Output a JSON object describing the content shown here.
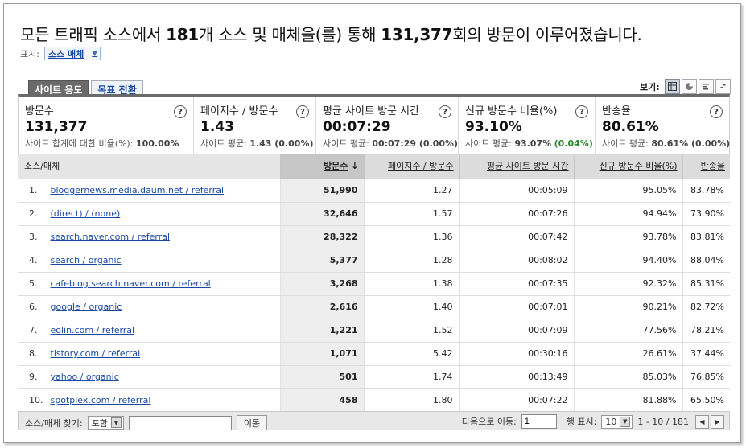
{
  "headline": {
    "part1": "모든 트래픽 소스에서 ",
    "sources": "181",
    "part2": "개 소스 및 매체을(를) 통해 ",
    "visits": "131,377",
    "part3": "회의 방문이 이루어졌습니다."
  },
  "display": {
    "label": "표시:",
    "value": "소스 매체"
  },
  "tabs": [
    {
      "label": "사이트 용도",
      "active": true
    },
    {
      "label": "목표 전환",
      "active": false
    }
  ],
  "view": {
    "label": "보기:",
    "icons": [
      "table-view-icon",
      "pie-view-icon",
      "performance-view-icon",
      "comparison-view-icon"
    ]
  },
  "metrics": [
    {
      "name": "방문수",
      "value": "131,377",
      "sub_label": "사이트 합계에 대한 비율(%): ",
      "sub_value": "100.00%",
      "sub_extra": ""
    },
    {
      "name": "페이지수 / 방문수",
      "value": "1.43",
      "sub_label": "사이트 평균: ",
      "sub_value": "1.43 (0.00%)",
      "sub_extra": ""
    },
    {
      "name": "평균 사이트 방문 시간",
      "value": "00:07:29",
      "sub_label": "사이트 평균: ",
      "sub_value": "00:07:29 (0.00%)",
      "sub_extra": ""
    },
    {
      "name": "신규 방문수 비율(%)",
      "value": "93.10%",
      "sub_label": "사이트 평균: ",
      "sub_value": "93.07%",
      "sub_extra": "(0.04%)"
    },
    {
      "name": "반송율",
      "value": "80.61%",
      "sub_label": "사이트 평균: ",
      "sub_value": "80.61% (0.00%)",
      "sub_extra": ""
    }
  ],
  "table": {
    "headers": [
      "소스/매체",
      "방문수",
      "페이지수 / 방문수",
      "평균 사이트 방문 시간",
      "신규 방문수 비율(%)",
      "반송율"
    ],
    "rows": [
      {
        "n": "1.",
        "source": "bloggernews.media.daum.net / referral",
        "visits": "51,990",
        "ppv": "1.27",
        "time": "00:05:09",
        "new": "95.05%",
        "bounce": "83.78%"
      },
      {
        "n": "2.",
        "source": "(direct) / (none)",
        "visits": "32,646",
        "ppv": "1.57",
        "time": "00:07:26",
        "new": "94.94%",
        "bounce": "73.90%"
      },
      {
        "n": "3.",
        "source": "search.naver.com / referral",
        "visits": "28,322",
        "ppv": "1.36",
        "time": "00:07:42",
        "new": "93.78%",
        "bounce": "83.81%"
      },
      {
        "n": "4.",
        "source": "search / organic",
        "visits": "5,377",
        "ppv": "1.28",
        "time": "00:08:02",
        "new": "94.40%",
        "bounce": "88.04%"
      },
      {
        "n": "5.",
        "source": "cafeblog.search.naver.com / referral",
        "visits": "3,268",
        "ppv": "1.38",
        "time": "00:07:35",
        "new": "92.32%",
        "bounce": "85.31%"
      },
      {
        "n": "6.",
        "source": "google / organic",
        "visits": "2,616",
        "ppv": "1.40",
        "time": "00:07:01",
        "new": "90.21%",
        "bounce": "82.72%"
      },
      {
        "n": "7.",
        "source": "eolin.com / referral",
        "visits": "1,221",
        "ppv": "1.52",
        "time": "00:07:09",
        "new": "77.56%",
        "bounce": "78.21%"
      },
      {
        "n": "8.",
        "source": "tistory.com / referral",
        "visits": "1,071",
        "ppv": "5.42",
        "time": "00:30:16",
        "new": "26.61%",
        "bounce": "37.44%"
      },
      {
        "n": "9.",
        "source": "yahoo / organic",
        "visits": "501",
        "ppv": "1.74",
        "time": "00:13:49",
        "new": "85.03%",
        "bounce": "76.85%"
      },
      {
        "n": "10.",
        "source": "spotplex.com / referral",
        "visits": "458",
        "ppv": "1.80",
        "time": "00:07:22",
        "new": "81.88%",
        "bounce": "65.50%"
      }
    ]
  },
  "footer": {
    "find_label": "소스/매체 찾기:",
    "match_value": "포함",
    "search_placeholder": "",
    "go_label": "이동",
    "goto_label": "다음으로 이동:",
    "goto_value": "1",
    "rows_label": "행 표시:",
    "rows_value": "10",
    "range": "1 - 10 / 181"
  }
}
